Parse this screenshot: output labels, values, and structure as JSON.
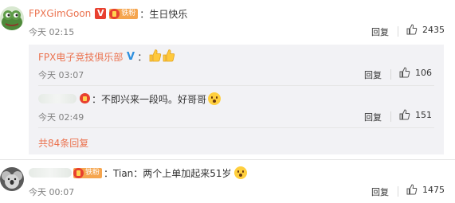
{
  "comments": [
    {
      "author": "FPXGimGoon",
      "badge_label": "铁粉",
      "separator": "：",
      "text": "生日快乐",
      "time": "今天 02:15",
      "reply_label": "回复",
      "likes": "2435"
    }
  ],
  "sub_comments": [
    {
      "author": "FPX电子竞技俱乐部",
      "separator": "：",
      "time": "今天 03:07",
      "reply_label": "回复",
      "likes": "106"
    },
    {
      "author": "",
      "separator": "：",
      "text": "不即兴来一段吗。好哥哥",
      "time": "今天 02:49",
      "reply_label": "回复",
      "likes": "151"
    }
  ],
  "more_replies_label": "共84条回复",
  "last_comment": {
    "author": "",
    "badge_label": "铁粉",
    "separator": "：",
    "text": "Tian：两个上单加起来51岁",
    "time": "今天 00:07",
    "reply_label": "回复",
    "likes": "1475"
  },
  "colors": {
    "name": "#eb7350",
    "link": "#eb7350",
    "time": "#808080",
    "panel": "#f2f2f5"
  },
  "icons": [
    "frog-avatar-icon",
    "vip-v-icon",
    "fan-badge-icon",
    "blue-v-icon",
    "thumbs-up-emoji-icon",
    "medal-icon",
    "surprised-emoji-icon",
    "like-icon",
    "koala-avatar-icon"
  ]
}
